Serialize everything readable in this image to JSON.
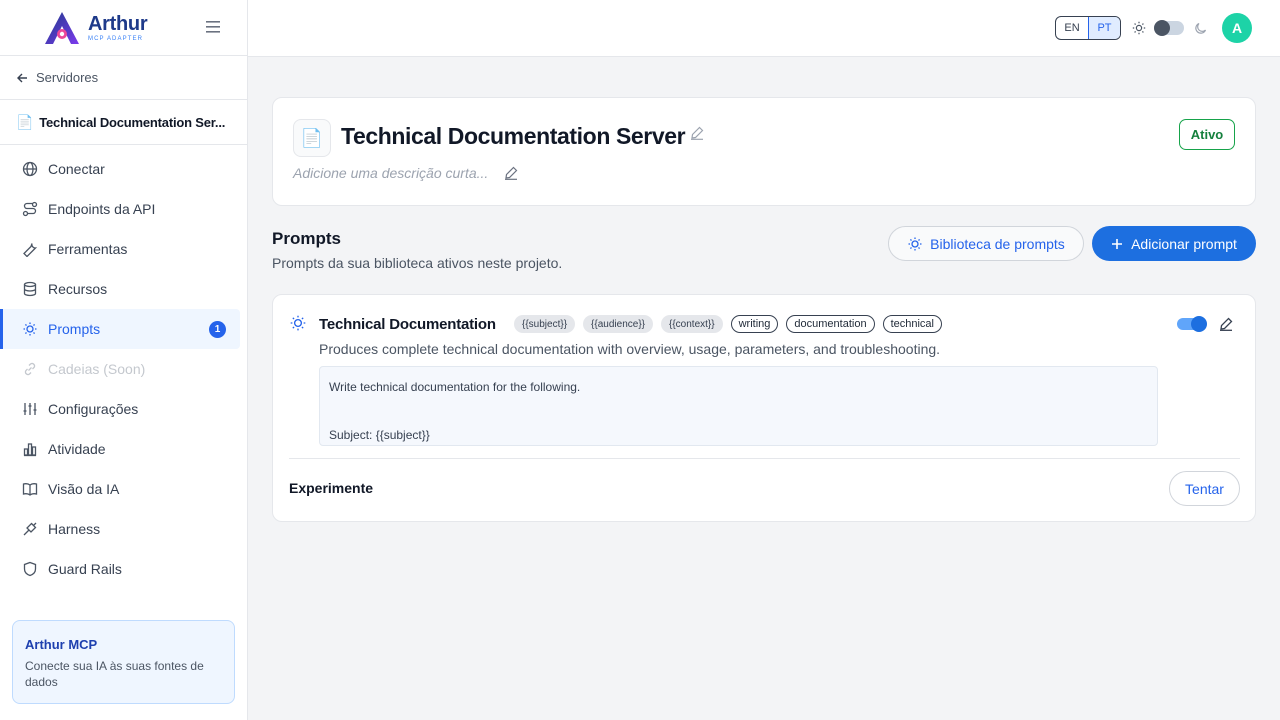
{
  "brand": {
    "name": "Arthur",
    "subtitle": "MCP ADAPTER"
  },
  "sidebar": {
    "back_label": "Servidores",
    "server_name": "Technical Documentation Ser...",
    "items": [
      {
        "label": "Conectar",
        "icon": "globe-icon"
      },
      {
        "label": "Endpoints da API",
        "icon": "route-icon"
      },
      {
        "label": "Ferramentas",
        "icon": "wrench-icon"
      },
      {
        "label": "Recursos",
        "icon": "database-icon"
      },
      {
        "label": "Prompts",
        "icon": "lightbulb-icon",
        "badge": "1",
        "active": true
      },
      {
        "label": "Cadeias (Soon)",
        "icon": "link-icon",
        "disabled": true
      },
      {
        "label": "Configurações",
        "icon": "sliders-icon"
      },
      {
        "label": "Atividade",
        "icon": "bar-chart-icon"
      },
      {
        "label": "Visão da IA",
        "icon": "book-icon"
      },
      {
        "label": "Harness",
        "icon": "harness-icon"
      },
      {
        "label": "Guard Rails",
        "icon": "shield-icon"
      }
    ],
    "promo": {
      "title": "Arthur MCP",
      "text": "Conecte sua IA às suas fontes de dados"
    }
  },
  "topbar": {
    "lang_en": "EN",
    "lang_pt": "PT",
    "active_lang": "PT",
    "avatar_initial": "A"
  },
  "server": {
    "title": "Technical Documentation Server",
    "description_placeholder": "Adicione uma descrição curta...",
    "status": "Ativo"
  },
  "prompts_section": {
    "title": "Prompts",
    "subtitle": "Prompts da sua biblioteca ativos neste projeto.",
    "library_button": "Biblioteca de prompts",
    "add_button": "Adicionar prompt"
  },
  "prompt": {
    "name": "Technical Documentation",
    "variables": [
      "{{subject}}",
      "{{audience}}",
      "{{context}}"
    ],
    "tags": [
      "writing",
      "documentation",
      "technical"
    ],
    "description": "Produces complete technical documentation with overview, usage, parameters, and troubleshooting.",
    "template_line1": "Write technical documentation for the following.",
    "template_line2": "Subject: {{subject}}",
    "enabled": true,
    "try_label": "Experimente",
    "try_button": "Tentar"
  },
  "colors": {
    "primary": "#1d6fe0",
    "status_green": "#16a34a",
    "avatar": "#1dd3a7"
  }
}
